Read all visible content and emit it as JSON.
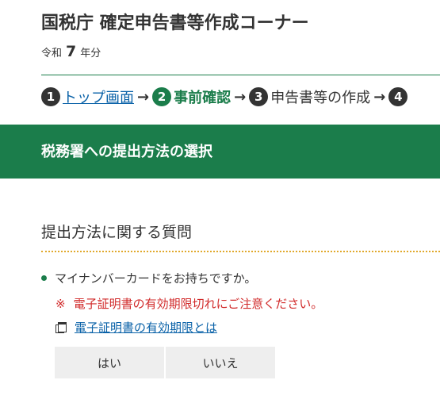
{
  "header": {
    "title": "国税庁 確定申告書等作成コーナー",
    "era_prefix": "令和",
    "era_year": "7",
    "era_suffix": "年分"
  },
  "steps": [
    {
      "number": "1",
      "label": "トップ画面",
      "state": "link"
    },
    {
      "number": "2",
      "label": "事前確認",
      "state": "active"
    },
    {
      "number": "3",
      "label": "申告書等の作成",
      "state": "pending"
    },
    {
      "number": "4",
      "label": "",
      "state": "pending"
    }
  ],
  "arrow_glyph": "→",
  "banner": {
    "title": "税務署への提出方法の選択"
  },
  "section": {
    "heading": "提出方法に関する質問",
    "question": "マイナンバーカードをお持ちですか。",
    "warning_mark": "※",
    "warning_text": "電子証明書の有効期限切れにご注意ください。",
    "help_link": "電子証明書の有効期限とは"
  },
  "answers": {
    "yes_label": "はい",
    "no_label": "いいえ"
  },
  "colors": {
    "brand_green": "#1b7d4b",
    "link_blue": "#0a62a8",
    "warning_red": "#d12a2a",
    "dotted_rule": "#e1a92c",
    "button_bg": "#eeeeee"
  },
  "icons": {
    "help_link_icon": "new-window-icon"
  }
}
